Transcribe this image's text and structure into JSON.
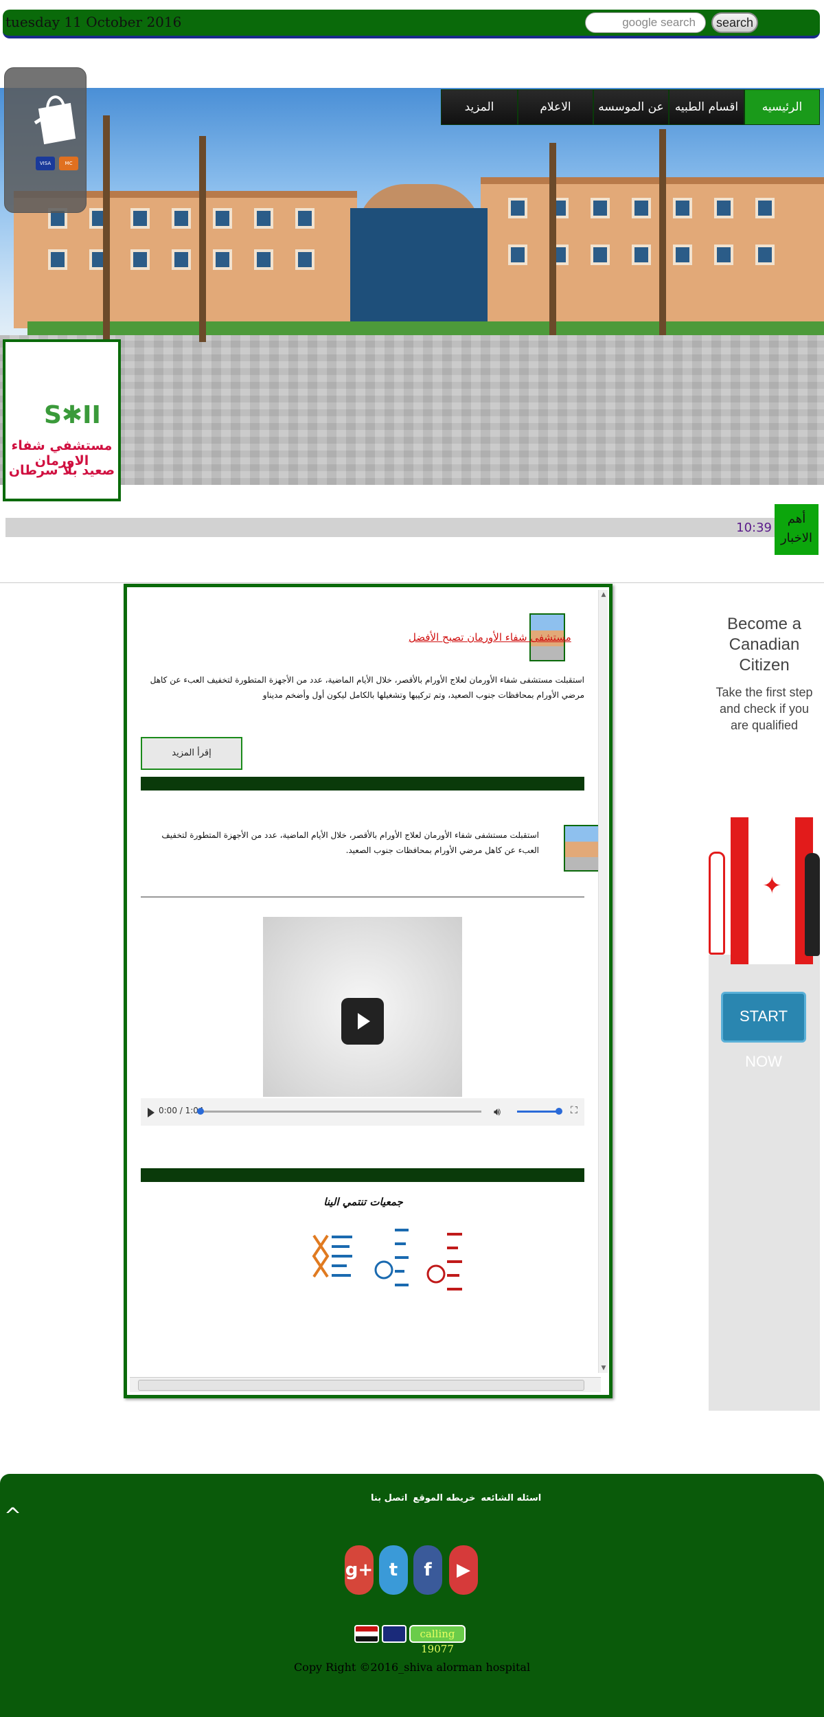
{
  "topbar": {
    "date": "tuesday 11 October 2016",
    "search_placeholder": "google search",
    "search_button": "search"
  },
  "nav": {
    "items": [
      {
        "label": "الرئيسيه",
        "active": true
      },
      {
        "label": "اقسام الطبيه",
        "active": false
      },
      {
        "label": "عن الموسسه",
        "active": false
      },
      {
        "label": "الاعلام",
        "active": false
      },
      {
        "label": "المزيد",
        "active": false
      }
    ]
  },
  "cart": {
    "icon": "shopping-bag-icon",
    "cards": [
      "VISA",
      "MC"
    ]
  },
  "logo": {
    "mark": "S✱II",
    "line1": "مستشفي شفاء الاورمان",
    "line2": "صعيد بلا سرطان"
  },
  "news": {
    "label": "أهم الاخبار",
    "ticker_text": "10:39"
  },
  "articles": [
    {
      "title": "مستشفى شفاء الأورمان تصبح الأفضل",
      "text": "استقبلت مستشفى شفاء الأورمان لعلاج الأورام بالأقصر، خلال الأيام الماضية، عدد من الأجهزة المتطورة لتخفيف العبء عن كاهل مرضي الأورام بمحافظات جنوب الصعيد، وتم تركيبها وتشغيلها بالكامل ليكون أول وأضخم مديناو",
      "more_button": "إقرأ المزيد"
    },
    {
      "text": "استقبلت مستشفى شفاء الأورمان لعلاج الأورام بالأقصر، خلال الأيام الماضية، عدد من الأجهزة المتطورة لتخفيف العبء عن كاهل مرضي الأورام بمحافظات جنوب الصعيد."
    }
  ],
  "video": {
    "time": "0:00 / 1:04",
    "progress": 0,
    "volume": 1.0
  },
  "partners": {
    "title": "جمعيات تنتمي الينا",
    "items": [
      {
        "name": "AFNCI",
        "color": "#e07a20"
      },
      {
        "name": "EGYPT CANCER NETWORK USA",
        "color": "#1a6ab0"
      },
      {
        "name": "EGYPT CANCER NETWORK",
        "color": "#c01a1a"
      }
    ]
  },
  "ad": {
    "headline_line1": "Become a",
    "headline_line2": "Canadian Citizen",
    "sub_line1": "Take the first step",
    "sub_line2": "and check if you",
    "sub_line3": "are qualified",
    "cta": "START NOW"
  },
  "footer": {
    "to_top": "^",
    "links": [
      "اسئله الشائعه",
      "خريطه الموقع",
      "اتصل بنا"
    ],
    "social": [
      {
        "icon": "google-plus-icon",
        "label": "g+",
        "color": "#d6463a"
      },
      {
        "icon": "twitter-icon",
        "label": "t",
        "color": "#3a9ad8"
      },
      {
        "icon": "facebook-icon",
        "label": "f",
        "color": "#3a5a9a"
      },
      {
        "icon": "youtube-icon",
        "label": "▶",
        "color": "#d63a3a"
      }
    ],
    "calling": "calling 19077",
    "copyright": "Copy Right ©2016_shiva alorman hospital"
  },
  "colors": {
    "brand_green": "#0a6a0a",
    "active_nav": "#1a9a1a",
    "title_red": "#d01010"
  }
}
